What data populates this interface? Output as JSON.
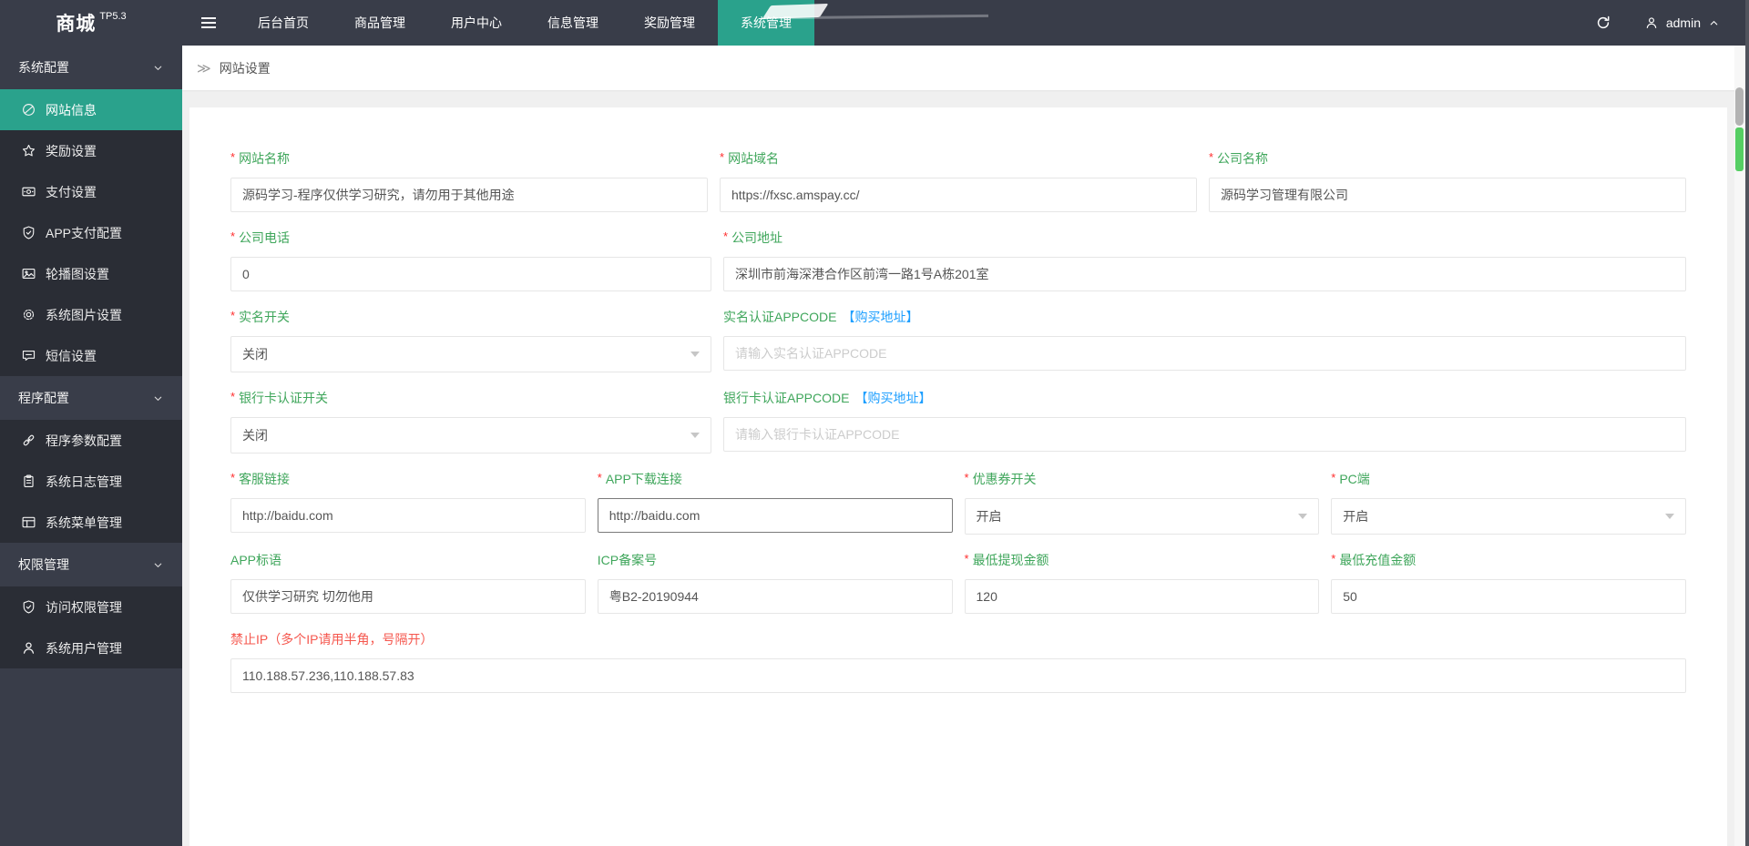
{
  "topbar": {
    "logo": "商城",
    "logo_sub": "TP5.3",
    "nav": [
      {
        "label": "后台首页",
        "active": false
      },
      {
        "label": "商品管理",
        "active": false
      },
      {
        "label": "用户中心",
        "active": false
      },
      {
        "label": "信息管理",
        "active": false
      },
      {
        "label": "奖励管理",
        "active": false
      },
      {
        "label": "系统管理",
        "active": true
      }
    ],
    "user": {
      "name": "admin"
    }
  },
  "sidebar": {
    "groups": [
      {
        "label": "系统配置",
        "items": [
          {
            "label": "网站信息",
            "icon": "site-icon",
            "active": true
          },
          {
            "label": "奖励设置",
            "icon": "star-icon",
            "active": false
          },
          {
            "label": "支付设置",
            "icon": "money-icon",
            "active": false
          },
          {
            "label": "APP支付配置",
            "icon": "shield-check-icon",
            "active": false
          },
          {
            "label": "轮播图设置",
            "icon": "image-icon",
            "active": false
          },
          {
            "label": "系统图片设置",
            "icon": "gear-icon",
            "active": false
          },
          {
            "label": "短信设置",
            "icon": "message-icon",
            "active": false
          }
        ]
      },
      {
        "label": "程序配置",
        "items": [
          {
            "label": "程序参数配置",
            "icon": "link-icon",
            "active": false
          },
          {
            "label": "系统日志管理",
            "icon": "log-icon",
            "active": false
          },
          {
            "label": "系统菜单管理",
            "icon": "menu-icon",
            "active": false
          }
        ]
      },
      {
        "label": "权限管理",
        "items": [
          {
            "label": "访问权限管理",
            "icon": "shield-check-icon",
            "active": false
          },
          {
            "label": "系统用户管理",
            "icon": "user-icon",
            "active": false
          }
        ]
      }
    ]
  },
  "breadcrumb": {
    "chevron_glyph": "≫",
    "title": "网站设置"
  },
  "form": {
    "rows": [
      {
        "layout": "c3",
        "fields": [
          {
            "name": "site-name",
            "label": "网站名称",
            "required": true,
            "type": "input",
            "value": "源码学习-程序仅供学习研究，请勿用于其他用途"
          },
          {
            "name": "site-domain",
            "label": "网站域名",
            "required": true,
            "type": "input",
            "value": "https://fxsc.amspay.cc/"
          },
          {
            "name": "company-name",
            "label": "公司名称",
            "required": true,
            "type": "input",
            "value": "源码学习管理有限公司"
          }
        ]
      },
      {
        "layout": "c2",
        "fields": [
          {
            "name": "company-phone",
            "label": "公司电话",
            "required": true,
            "type": "input",
            "value": "0"
          },
          {
            "name": "company-address",
            "label": "公司地址",
            "required": true,
            "type": "input",
            "value": "深圳市前海深港合作区前湾一路1号A栋201室"
          }
        ]
      },
      {
        "layout": "c2",
        "fields": [
          {
            "name": "realname-switch",
            "label": "实名开关",
            "required": true,
            "type": "select",
            "value": "关闭"
          },
          {
            "name": "realname-appcode",
            "label": "实名认证APPCODE",
            "link": "【购买地址】",
            "required": false,
            "type": "input",
            "value": "",
            "placeholder": "请输入实名认证APPCODE"
          }
        ]
      },
      {
        "layout": "c2",
        "fields": [
          {
            "name": "bankcard-switch",
            "label": "银行卡认证开关",
            "required": true,
            "type": "select",
            "value": "关闭"
          },
          {
            "name": "bankcard-appcode",
            "label": "银行卡认证APPCODE",
            "link": "【购买地址】",
            "required": false,
            "type": "input",
            "value": "",
            "placeholder": "请输入银行卡认证APPCODE"
          }
        ]
      },
      {
        "layout": "c4",
        "fields": [
          {
            "name": "service-link",
            "label": "客服链接",
            "required": true,
            "type": "input",
            "value": "http://baidu.com"
          },
          {
            "name": "app-download-link",
            "label": "APP下载连接",
            "required": true,
            "type": "input",
            "value": "http://baidu.com",
            "focused": true
          },
          {
            "name": "coupon-switch",
            "label": "优惠券开关",
            "required": true,
            "type": "select",
            "value": "开启"
          },
          {
            "name": "pc-switch",
            "label": "PC端",
            "required": true,
            "type": "select",
            "value": "开启"
          }
        ]
      },
      {
        "layout": "c4",
        "fields": [
          {
            "name": "app-slogan",
            "label": "APP标语",
            "required": false,
            "type": "input",
            "value": "仅供学习研究 切勿他用"
          },
          {
            "name": "icp-number",
            "label": "ICP备案号",
            "required": false,
            "type": "input",
            "value": "粤B2-20190944"
          },
          {
            "name": "min-withdraw",
            "label": "最低提现金额",
            "required": true,
            "type": "input",
            "value": "120"
          },
          {
            "name": "min-recharge",
            "label": "最低充值金额",
            "required": true,
            "type": "input",
            "value": "50"
          }
        ]
      },
      {
        "layout": "full",
        "fields": [
          {
            "name": "banned-ip",
            "label": "禁止IP（多个IP请用半角，号隔开）",
            "required": false,
            "label_color": "red",
            "type": "input",
            "value": "110.188.57.236,110.188.57.83"
          }
        ]
      }
    ]
  },
  "colors": {
    "topbar_bg": "#393D49",
    "sidebar_sub_bg": "#2A2D35",
    "accent_teal": "#2AA28C",
    "label_green": "#3FA65B",
    "label_red": "#f5574e",
    "asterisk_red": "#ff2d2d",
    "link_blue": "#1e9fff",
    "scrollbar_green": "#55CE63"
  }
}
